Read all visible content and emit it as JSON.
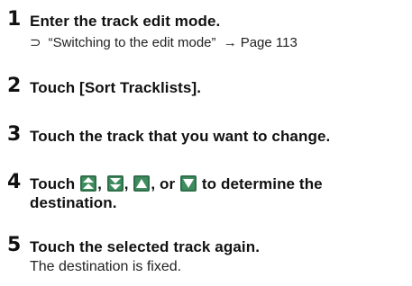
{
  "steps": [
    {
      "number": "1",
      "text": "Enter the track edit mode.",
      "ref": {
        "arrow": "⊃",
        "quote": "“Switching to the edit mode”",
        "pointer": "→",
        "page": "Page 113"
      }
    },
    {
      "number": "2",
      "text": "Touch [Sort Tracklists]."
    },
    {
      "number": "3",
      "text": "Touch the track that you want to change."
    },
    {
      "number": "4",
      "text_before": "Touch",
      "sep1": ",",
      "sep2": ",",
      "sep3": ", or",
      "text_after": "to determine the",
      "text_line2": "destination.",
      "icons": [
        "move-to-top-icon",
        "move-to-bottom-icon",
        "move-up-icon",
        "move-down-icon"
      ]
    },
    {
      "number": "5",
      "text": "Touch the selected track again.",
      "note": "The destination is fixed."
    }
  ]
}
